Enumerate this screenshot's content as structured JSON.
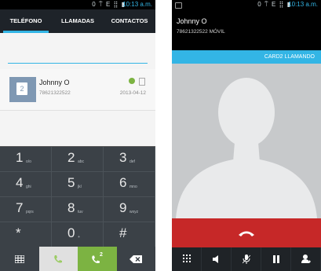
{
  "left": {
    "status": {
      "time": "10:13 a.m.",
      "icons": "0 ⍑ E ⣿ ▮"
    },
    "tabs": [
      "TELÉFONO",
      "LLAMADAS",
      "CONTACTOS"
    ],
    "contact": {
      "name": "Johnny O",
      "number": "78621322522",
      "date": "2013-04-12",
      "sim_label": "2"
    },
    "keypad": [
      {
        "digit": "1",
        "letters": "o/o"
      },
      {
        "digit": "2",
        "letters": "abc"
      },
      {
        "digit": "3",
        "letters": "def"
      },
      {
        "digit": "4",
        "letters": "ghi"
      },
      {
        "digit": "5",
        "letters": "jkl"
      },
      {
        "digit": "6",
        "letters": "mno"
      },
      {
        "digit": "7",
        "letters": "pqrs"
      },
      {
        "digit": "8",
        "letters": "tuv"
      },
      {
        "digit": "9",
        "letters": "wxyz"
      },
      {
        "digit": "*",
        "letters": ""
      },
      {
        "digit": "0",
        "letters": "+"
      },
      {
        "digit": "#",
        "letters": ""
      }
    ],
    "call2_label": "2"
  },
  "right": {
    "status": {
      "time": "10:13 a.m.",
      "icons": "0 ⍑ E ⣿ ▮"
    },
    "caller": {
      "name": "Johnny O",
      "number": "78621322522 MÓVIL"
    },
    "card_status": "CARD2 LLAMANDO"
  },
  "colors": {
    "accent": "#33b5e5",
    "green": "#7cb342",
    "red": "#c62828"
  }
}
